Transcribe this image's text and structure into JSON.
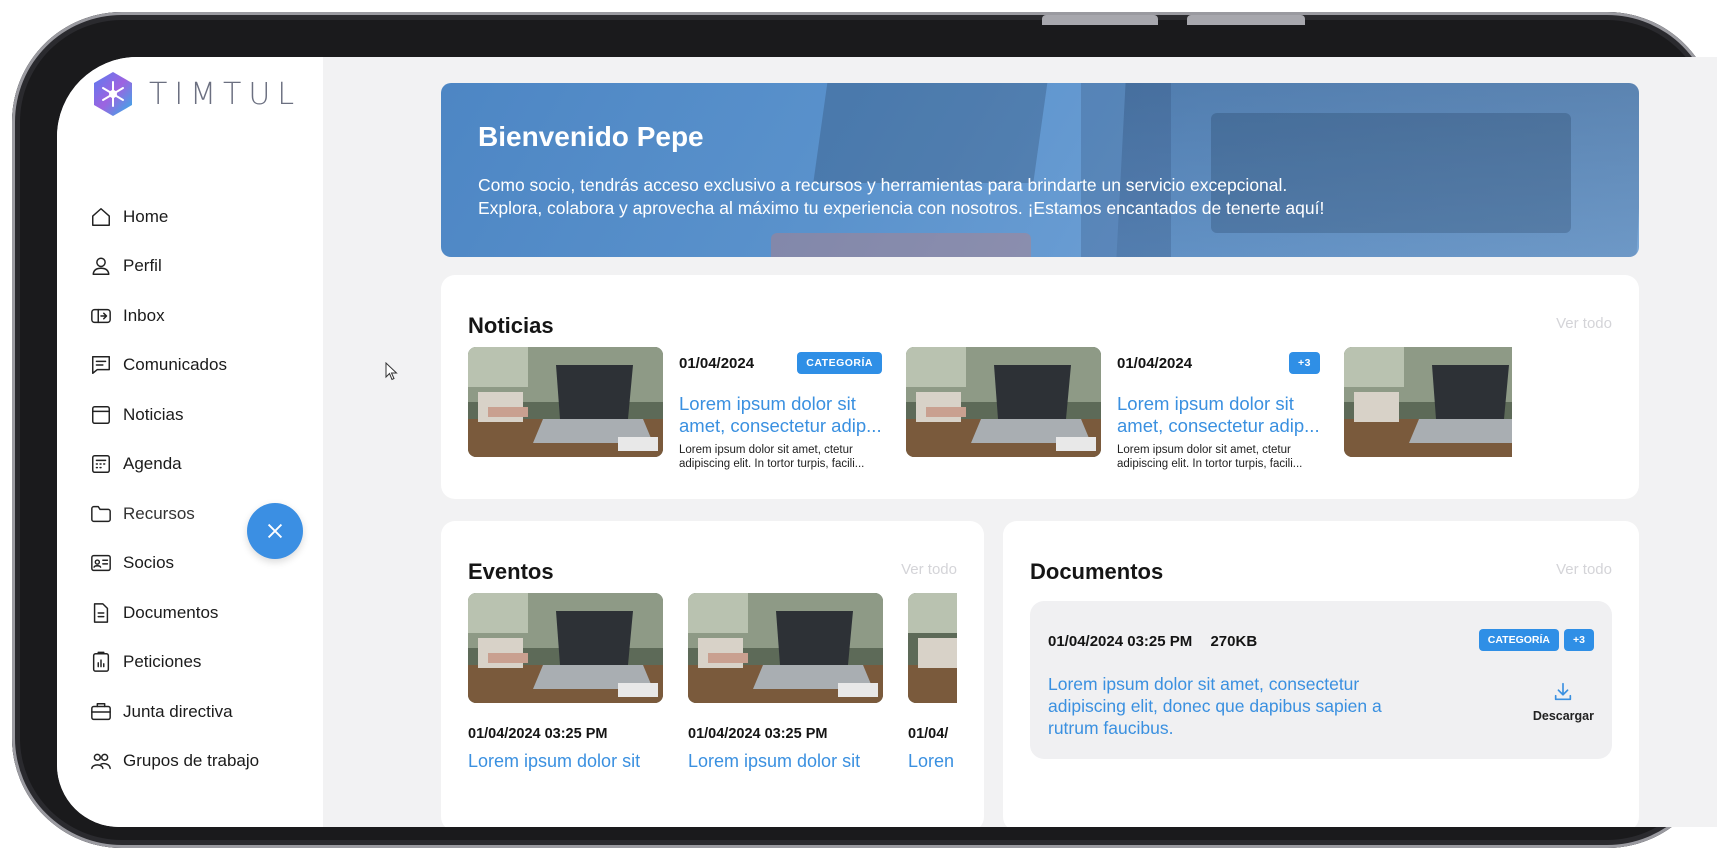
{
  "app": {
    "logo_text": "TIMTUL"
  },
  "sidebar": {
    "items": [
      {
        "label": "Home",
        "icon": "home-icon"
      },
      {
        "label": "Perfil",
        "icon": "user-icon"
      },
      {
        "label": "Inbox",
        "icon": "inbox-icon"
      },
      {
        "label": "Comunicados",
        "icon": "announcement-icon"
      },
      {
        "label": "Noticias",
        "icon": "news-icon"
      },
      {
        "label": "Agenda",
        "icon": "calendar-icon"
      },
      {
        "label": "Recursos",
        "icon": "folder-icon"
      },
      {
        "label": "Socios",
        "icon": "id-card-icon"
      },
      {
        "label": "Documentos",
        "icon": "document-icon"
      },
      {
        "label": "Peticiones",
        "icon": "request-icon"
      },
      {
        "label": "Junta directiva",
        "icon": "briefcase-icon"
      },
      {
        "label": "Grupos de trabajo",
        "icon": "group-icon"
      }
    ]
  },
  "banner": {
    "title": "Bienvenido Pepe",
    "line1": "Como socio, tendrás acceso exclusivo a recursos y herramientas para brindarte un servicio excepcional.",
    "line2": "Explora, colabora y aprovecha al máximo tu experiencia con nosotros. ¡Estamos encantados de tenerte aquí!"
  },
  "noticias": {
    "title": "Noticias",
    "see_all": "Ver todo",
    "items": [
      {
        "date": "01/04/2024",
        "tag": "CATEGORÍA",
        "title": "Lorem ipsum dolor sit amet, consectetur adip...",
        "body": "Lorem ipsum dolor sit amet, ctetur adipiscing elit. In tortor turpis, facili..."
      },
      {
        "date": "01/04/2024",
        "tag": "+3",
        "title": "Lorem ipsum dolor sit amet, consectetur adip...",
        "body": "Lorem ipsum dolor sit amet, ctetur adipiscing elit. In tortor turpis, facili..."
      }
    ]
  },
  "eventos": {
    "title": "Eventos",
    "see_all": "Ver todo",
    "items": [
      {
        "date": "01/04/2024 03:25 PM",
        "title": "Lorem ipsum dolor sit"
      },
      {
        "date": "01/04/2024 03:25 PM",
        "title": "Lorem ipsum dolor sit"
      },
      {
        "date": "01/04/",
        "title": "Loren"
      }
    ]
  },
  "documentos": {
    "title": "Documentos",
    "see_all": "Ver todo",
    "item": {
      "datetime": "01/04/2024 03:25 PM",
      "size": "270KB",
      "tag1": "CATEGORÍA",
      "tag2": "+3",
      "text": "Lorem ipsum dolor sit amet, consectetur adipiscing elit, donec que dapibus sapien a rutrum faucibus.",
      "download": "Descargar"
    }
  },
  "colors": {
    "accent": "#2f8fe6",
    "link": "#3a90e0",
    "fab": "#3b8fe3"
  }
}
